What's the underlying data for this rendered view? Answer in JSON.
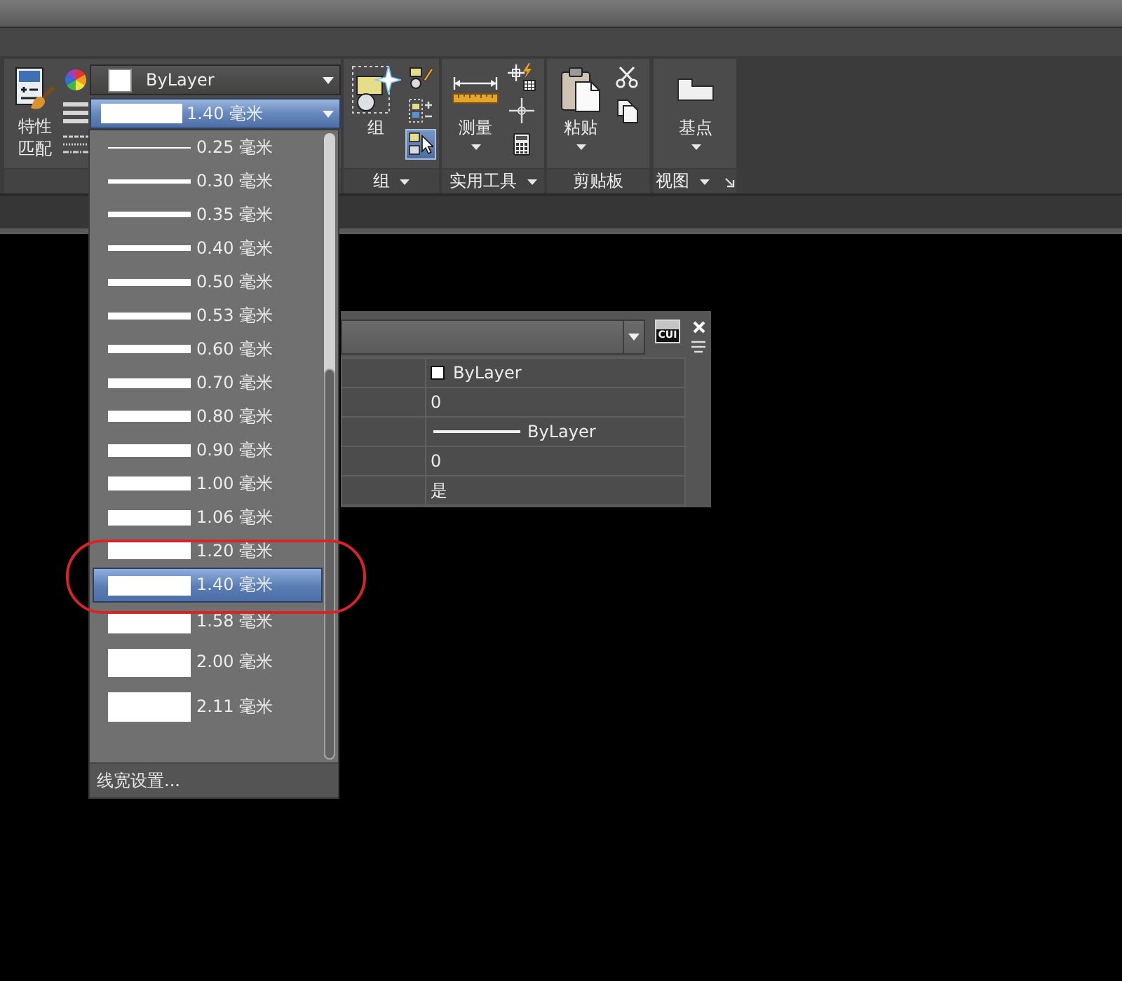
{
  "ribbon": {
    "properties_panel": {
      "match_button": {
        "label": "特性匹配"
      },
      "color_combo": {
        "value": "ByLayer"
      },
      "lineweight_combo": {
        "value": "1.40 毫米",
        "expanded": true
      }
    },
    "panels": [
      {
        "kind": "group",
        "title": "组",
        "menu": true,
        "launcher": false,
        "big_button": {
          "label": "组",
          "dropdown": false
        },
        "small_buttons": [
          {
            "kind": "group-edit",
            "on": false
          },
          {
            "kind": "group-select",
            "on": false
          },
          {
            "kind": "select-cursor",
            "on": true
          }
        ]
      },
      {
        "kind": "measure",
        "title": "实用工具",
        "menu": true,
        "launcher": false,
        "big_button": {
          "label": "测量",
          "dropdown": true
        },
        "small_buttons": [
          {
            "kind": "quick-select",
            "on": false
          },
          {
            "kind": "point",
            "on": false
          },
          {
            "kind": "calculator",
            "on": false
          }
        ]
      },
      {
        "kind": "paste",
        "title": "剪贴板",
        "menu": false,
        "launcher": false,
        "big_button": {
          "label": "粘贴",
          "dropdown": true
        },
        "small_buttons": [
          {
            "kind": "cut",
            "on": false
          },
          {
            "kind": "copy",
            "on": false
          }
        ]
      },
      {
        "kind": "basepoint",
        "title": "视图",
        "menu": true,
        "launcher": true,
        "big_button": {
          "label": "基点",
          "dropdown": true
        }
      }
    ]
  },
  "lineweight_list": {
    "items": [
      {
        "label": "0.25 毫米",
        "selected": false,
        "circled": false
      },
      {
        "label": "0.30 毫米",
        "selected": false,
        "circled": false
      },
      {
        "label": "0.35 毫米",
        "selected": false,
        "circled": false
      },
      {
        "label": "0.40 毫米",
        "selected": false,
        "circled": false
      },
      {
        "label": "0.50 毫米",
        "selected": false,
        "circled": false
      },
      {
        "label": "0.53 毫米",
        "selected": false,
        "circled": false
      },
      {
        "label": "0.60 毫米",
        "selected": false,
        "circled": false
      },
      {
        "label": "0.70 毫米",
        "selected": false,
        "circled": false
      },
      {
        "label": "0.80 毫米",
        "selected": false,
        "circled": false
      },
      {
        "label": "0.90 毫米",
        "selected": false,
        "circled": false
      },
      {
        "label": "1.00 毫米",
        "selected": false,
        "circled": false
      },
      {
        "label": "1.06 毫米",
        "selected": false,
        "circled": false
      },
      {
        "label": "1.20 毫米",
        "selected": false,
        "circled": true
      },
      {
        "label": "1.40 毫米",
        "selected": true,
        "circled": true
      },
      {
        "label": "1.58 毫米",
        "selected": false,
        "circled": false
      },
      {
        "label": "2.00 毫米",
        "selected": false,
        "circled": false
      },
      {
        "label": "2.11 毫米",
        "selected": false,
        "circled": false
      }
    ],
    "footer": "线宽设置..."
  },
  "properties_palette": {
    "cui_button": {
      "label": "CUI"
    },
    "rows": [
      {
        "kind": "color",
        "value": "ByLayer"
      },
      {
        "kind": "text",
        "value": "0"
      },
      {
        "kind": "linetype",
        "value": "ByLayer"
      },
      {
        "kind": "text",
        "value": "0"
      },
      {
        "kind": "text",
        "value": "是"
      }
    ]
  }
}
